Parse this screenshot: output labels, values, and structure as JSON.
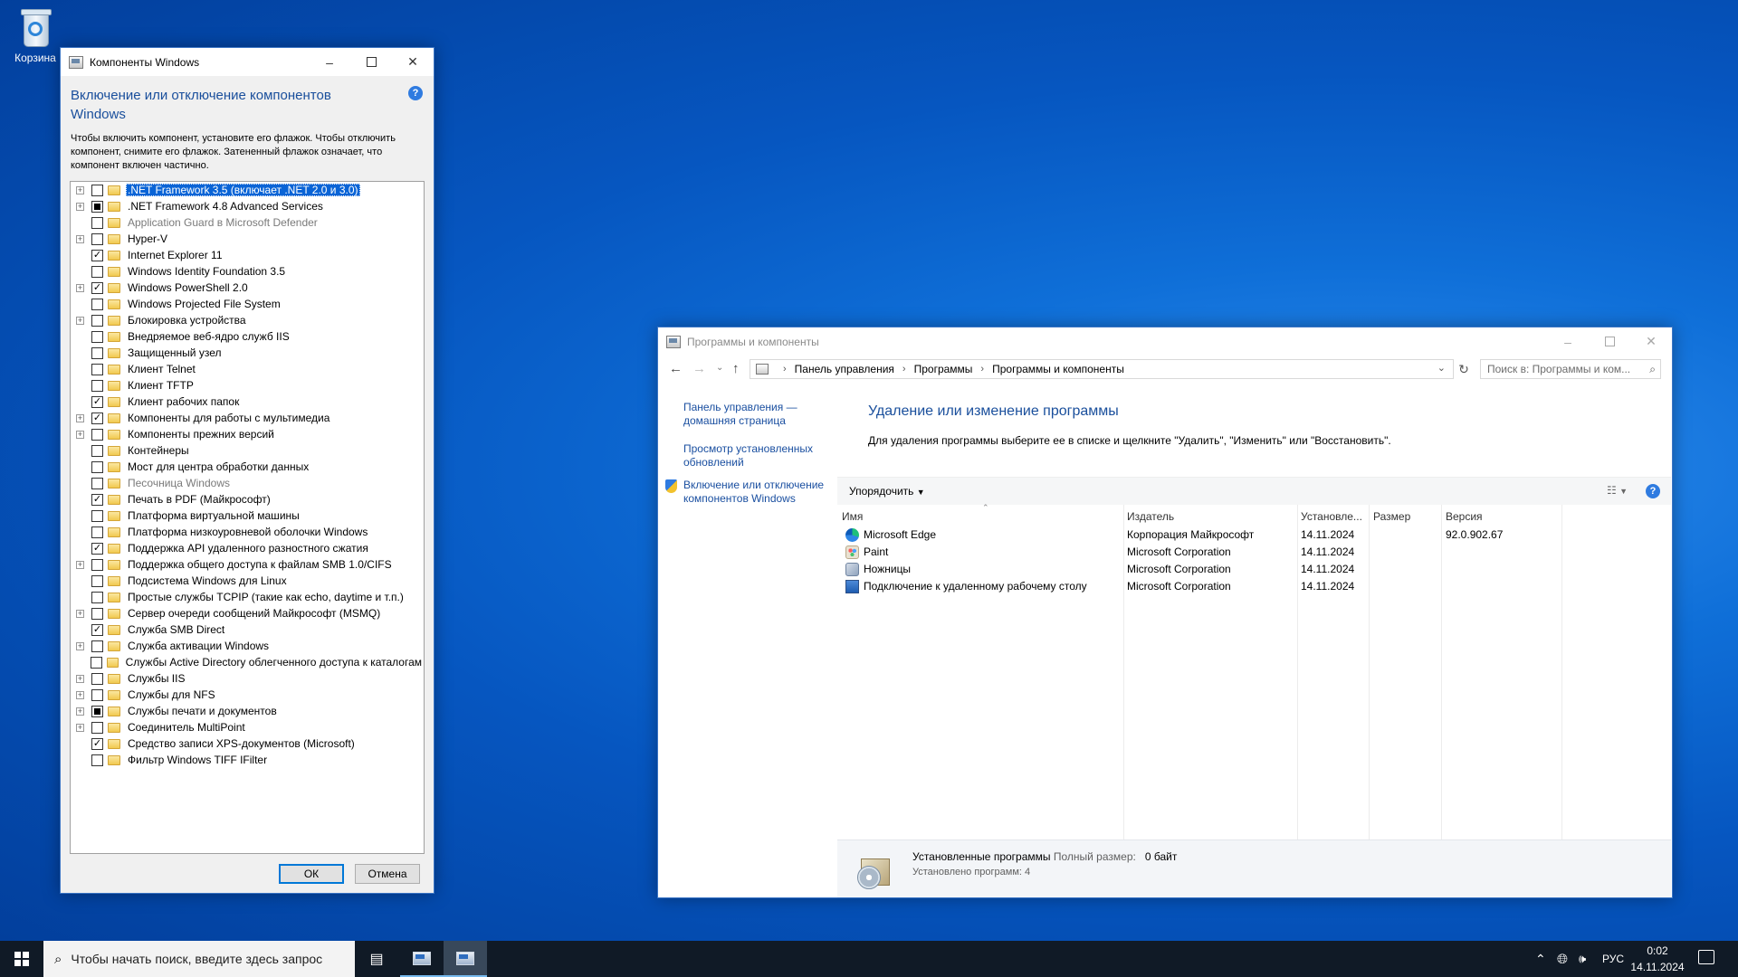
{
  "desktop": {
    "recycle_bin_label": "Корзина"
  },
  "features_dialog": {
    "title": "Компоненты Windows",
    "heading": "Включение или отключение компонентов Windows",
    "description": "Чтобы включить компонент, установите его флажок. Чтобы отключить компонент, снимите его флажок. Затененный флажок означает, что компонент включен частично.",
    "help": "?",
    "items": [
      {
        "label": ".NET Framework 3.5 (включает .NET 2.0 и 3.0)",
        "state": "unchecked",
        "expandable": true,
        "selected": true,
        "dim": false
      },
      {
        "label": ".NET Framework 4.8 Advanced Services",
        "state": "partial",
        "expandable": true,
        "selected": false,
        "dim": false
      },
      {
        "label": "Application Guard в Microsoft Defender",
        "state": "unchecked",
        "expandable": false,
        "selected": false,
        "dim": true
      },
      {
        "label": "Hyper-V",
        "state": "unchecked",
        "expandable": true,
        "selected": false,
        "dim": false
      },
      {
        "label": "Internet Explorer 11",
        "state": "checked",
        "expandable": false,
        "selected": false,
        "dim": false
      },
      {
        "label": "Windows Identity Foundation 3.5",
        "state": "unchecked",
        "expandable": false,
        "selected": false,
        "dim": false
      },
      {
        "label": "Windows PowerShell 2.0",
        "state": "checked",
        "expandable": true,
        "selected": false,
        "dim": false
      },
      {
        "label": "Windows Projected File System",
        "state": "unchecked",
        "expandable": false,
        "selected": false,
        "dim": false
      },
      {
        "label": "Блокировка устройства",
        "state": "unchecked",
        "expandable": true,
        "selected": false,
        "dim": false
      },
      {
        "label": "Внедряемое веб-ядро служб IIS",
        "state": "unchecked",
        "expandable": false,
        "selected": false,
        "dim": false
      },
      {
        "label": "Защищенный узел",
        "state": "unchecked",
        "expandable": false,
        "selected": false,
        "dim": false
      },
      {
        "label": "Клиент Telnet",
        "state": "unchecked",
        "expandable": false,
        "selected": false,
        "dim": false
      },
      {
        "label": "Клиент TFTP",
        "state": "unchecked",
        "expandable": false,
        "selected": false,
        "dim": false
      },
      {
        "label": "Клиент рабочих папок",
        "state": "checked",
        "expandable": false,
        "selected": false,
        "dim": false
      },
      {
        "label": "Компоненты для работы с мультимедиа",
        "state": "checked",
        "expandable": true,
        "selected": false,
        "dim": false
      },
      {
        "label": "Компоненты прежних версий",
        "state": "unchecked",
        "expandable": true,
        "selected": false,
        "dim": false
      },
      {
        "label": "Контейнеры",
        "state": "unchecked",
        "expandable": false,
        "selected": false,
        "dim": false
      },
      {
        "label": "Мост для центра обработки данных",
        "state": "unchecked",
        "expandable": false,
        "selected": false,
        "dim": false
      },
      {
        "label": "Песочница Windows",
        "state": "unchecked",
        "expandable": false,
        "selected": false,
        "dim": true
      },
      {
        "label": "Печать в PDF (Майкрософт)",
        "state": "checked",
        "expandable": false,
        "selected": false,
        "dim": false
      },
      {
        "label": "Платформа виртуальной машины",
        "state": "unchecked",
        "expandable": false,
        "selected": false,
        "dim": false
      },
      {
        "label": "Платформа низкоуровневой оболочки Windows",
        "state": "unchecked",
        "expandable": false,
        "selected": false,
        "dim": false
      },
      {
        "label": "Поддержка API удаленного разностного сжатия",
        "state": "checked",
        "expandable": false,
        "selected": false,
        "dim": false
      },
      {
        "label": "Поддержка общего доступа к файлам SMB 1.0/CIFS",
        "state": "unchecked",
        "expandable": true,
        "selected": false,
        "dim": false
      },
      {
        "label": "Подсистема Windows для Linux",
        "state": "unchecked",
        "expandable": false,
        "selected": false,
        "dim": false
      },
      {
        "label": "Простые службы TCPIP (такие как echo, daytime и т.п.)",
        "state": "unchecked",
        "expandable": false,
        "selected": false,
        "dim": false
      },
      {
        "label": "Сервер очереди сообщений Майкрософт (MSMQ)",
        "state": "unchecked",
        "expandable": true,
        "selected": false,
        "dim": false
      },
      {
        "label": "Служба SMB Direct",
        "state": "checked",
        "expandable": false,
        "selected": false,
        "dim": false
      },
      {
        "label": "Служба активации Windows",
        "state": "unchecked",
        "expandable": true,
        "selected": false,
        "dim": false
      },
      {
        "label": "Службы Active Directory облегченного доступа к каталогам",
        "state": "unchecked",
        "expandable": false,
        "selected": false,
        "dim": false
      },
      {
        "label": "Службы IIS",
        "state": "unchecked",
        "expandable": true,
        "selected": false,
        "dim": false
      },
      {
        "label": "Службы для NFS",
        "state": "unchecked",
        "expandable": true,
        "selected": false,
        "dim": false
      },
      {
        "label": "Службы печати и документов",
        "state": "partial",
        "expandable": true,
        "selected": false,
        "dim": false
      },
      {
        "label": "Соединитель MultiPoint",
        "state": "unchecked",
        "expandable": true,
        "selected": false,
        "dim": false
      },
      {
        "label": "Средство записи XPS-документов (Microsoft)",
        "state": "checked",
        "expandable": false,
        "selected": false,
        "dim": false
      },
      {
        "label": "Фильтр Windows TIFF IFilter",
        "state": "unchecked",
        "expandable": false,
        "selected": false,
        "dim": false
      }
    ],
    "ok_label": "ОК",
    "cancel_label": "Отмена"
  },
  "programs_window": {
    "title": "Программы и компоненты",
    "breadcrumb": [
      "Панель управления",
      "Программы",
      "Программы и компоненты"
    ],
    "search_placeholder": "Поиск в: Программы и ком...",
    "left_links": [
      "Панель управления — домашняя страница",
      "Просмотр установленных обновлений",
      "Включение или отключение компонентов Windows"
    ],
    "heading": "Удаление или изменение программы",
    "subheading": "Для удаления программы выберите ее в списке и щелкните \"Удалить\", \"Изменить\" или \"Восстановить\".",
    "organize_label": "Упорядочить",
    "help": "?",
    "columns": [
      "Имя",
      "Издатель",
      "Установле...",
      "Размер",
      "Версия"
    ],
    "programs": [
      {
        "name": "Microsoft Edge",
        "publisher": "Корпорация Майкрософт",
        "installed": "14.11.2024",
        "size": "",
        "version": "92.0.902.67",
        "icon": "edge-icon"
      },
      {
        "name": "Paint",
        "publisher": "Microsoft Corporation",
        "installed": "14.11.2024",
        "size": "",
        "version": "",
        "icon": "paint-icon"
      },
      {
        "name": "Ножницы",
        "publisher": "Microsoft Corporation",
        "installed": "14.11.2024",
        "size": "",
        "version": "",
        "icon": "snipping-tool-icon"
      },
      {
        "name": "Подключение к удаленному рабочему столу",
        "publisher": "Microsoft Corporation",
        "installed": "14.11.2024",
        "size": "",
        "version": "",
        "icon": "remote-desktop-icon"
      }
    ],
    "details": {
      "title": "Установленные программы",
      "total_label": "Полный размер:",
      "total_value": "0 байт",
      "count_text": "Установлено программ: 4"
    }
  },
  "taskbar": {
    "search_placeholder": "Чтобы начать поиск, введите здесь запрос",
    "language": "РУС",
    "time": "0:02",
    "date": "14.11.2024"
  },
  "colors": {
    "accent": "#0078d7",
    "link": "#1a4fa0",
    "heading": "#1a4f9c",
    "selection": "#0a64d6",
    "taskbar": "#101a26"
  }
}
